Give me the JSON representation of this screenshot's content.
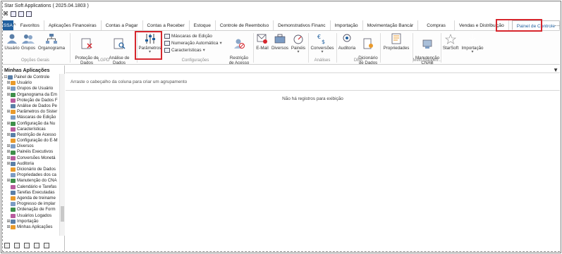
{
  "window": {
    "title": "Star Soft Applications ( 2025.04.1803 )"
  },
  "tabs": {
    "ssa": "SSA 2025",
    "items": [
      "Favoritos",
      "Aplicações Financeiras",
      "Contas a Pagar",
      "Contas a Receber",
      "Estoque",
      "Controle de Reembolso",
      "Demonstrativos Financ",
      "Importação",
      "Movimentação Bancár",
      "Compras",
      "Vendas e Distribuição",
      "Painel de Controle"
    ],
    "more": "⋯"
  },
  "ribbon": {
    "usuario": "Usuário",
    "grupos": "Grupos",
    "organograma": "Organograma",
    "opcoes_gerais": "Opções Gerais",
    "protecao": "Proteção de\nDados Pessoais",
    "analise": "Análise de\nDados Pessoais",
    "lgpd": "LGPD",
    "parametros": "Parâmetros",
    "mascaras": "Máscaras de Edição",
    "numeracao": "Numeração Automática",
    "caracteristicas": "Características",
    "restricao": "Restrição\nde Acesso",
    "configuracoes": "Configurações",
    "email": "E-Mail",
    "diversos": "Diversos",
    "paineis": "Painéis",
    "conversoes": "Conversões",
    "analises": "Análises",
    "auditoria": "Auditoria",
    "dicionario": "Dicionário\nde Dados",
    "dba": "DBA",
    "propriedades": "Propriedades",
    "manutencao": "Manutenção\nCNAB",
    "meio_magnetico": "Meio Magnéti...",
    "starsoft": "StarSoft",
    "importacao": "Importação"
  },
  "sidebar": {
    "title": "Minhas Aplicações",
    "items": [
      {
        "label": "Painel de Controle",
        "exp": "⊟",
        "indent": 0
      },
      {
        "label": "Usuário",
        "exp": "⊞",
        "indent": 1
      },
      {
        "label": "Grupos de Usuário",
        "exp": "⊞",
        "indent": 1
      },
      {
        "label": "Organograma da Em",
        "exp": "⊞",
        "indent": 1
      },
      {
        "label": "Proteção de Dados F",
        "exp": "",
        "indent": 1
      },
      {
        "label": "Análise de Dados Pe",
        "exp": "",
        "indent": 1
      },
      {
        "label": "Parâmetros do Sister",
        "exp": "⊞",
        "indent": 1
      },
      {
        "label": "Máscaras de Edição",
        "exp": "",
        "indent": 1
      },
      {
        "label": "Configuração da Nu",
        "exp": "⊞",
        "indent": 1
      },
      {
        "label": "Características",
        "exp": "",
        "indent": 1
      },
      {
        "label": "Restrição de Acesso",
        "exp": "⊞",
        "indent": 1
      },
      {
        "label": "Configuração do E-M",
        "exp": "",
        "indent": 1
      },
      {
        "label": "Diversos",
        "exp": "⊞",
        "indent": 1
      },
      {
        "label": "Painéis Executivos",
        "exp": "⊞",
        "indent": 1
      },
      {
        "label": "Conversões Monetá",
        "exp": "⊞",
        "indent": 1
      },
      {
        "label": "Auditoria",
        "exp": "⊞",
        "indent": 1
      },
      {
        "label": "Dicionário de Dados",
        "exp": "",
        "indent": 1
      },
      {
        "label": "Propriedades dos ca",
        "exp": "",
        "indent": 1
      },
      {
        "label": "Manutenção do CNA",
        "exp": "⊞",
        "indent": 1
      },
      {
        "label": "Calendário e Tarefas",
        "exp": "",
        "indent": 1
      },
      {
        "label": "Tarefas Executadas",
        "exp": "",
        "indent": 1
      },
      {
        "label": "Agenda de treiname",
        "exp": "",
        "indent": 1
      },
      {
        "label": "Progresso de implar",
        "exp": "",
        "indent": 1
      },
      {
        "label": "Ordenação de Form",
        "exp": "",
        "indent": 1
      },
      {
        "label": "Usuários Logados",
        "exp": "",
        "indent": 1
      },
      {
        "label": "Importação",
        "exp": "⊞",
        "indent": 1
      },
      {
        "label": "Minhas Aplicações",
        "exp": "⊞",
        "indent": 1
      }
    ]
  },
  "grid": {
    "group_hint": "Arraste o cabeçalho da coluna para criar um agrupamento",
    "empty": "Não há registros para exibição"
  },
  "colors": {
    "accent": "#1f5f9e",
    "highlight": "#d6262d"
  }
}
